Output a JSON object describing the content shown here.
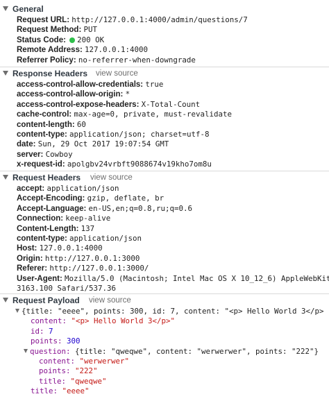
{
  "general": {
    "title": "General",
    "rows": [
      {
        "key": "Request URL:",
        "value": "http://127.0.0.1:4000/admin/questions/7"
      },
      {
        "key": "Request Method:",
        "value": "PUT"
      },
      {
        "key": "Status Code:",
        "value": "200 OK"
      },
      {
        "key": "Remote Address:",
        "value": "127.0.0.1:4000"
      },
      {
        "key": "Referrer Policy:",
        "value": "no-referrer-when-downgrade"
      }
    ]
  },
  "response_headers": {
    "title": "Response Headers",
    "view_source": "view source",
    "rows": [
      {
        "key": "access-control-allow-credentials:",
        "value": "true"
      },
      {
        "key": "access-control-allow-origin:",
        "value": "*"
      },
      {
        "key": "access-control-expose-headers:",
        "value": "X-Total-Count"
      },
      {
        "key": "cache-control:",
        "value": "max-age=0, private, must-revalidate"
      },
      {
        "key": "content-length:",
        "value": "60"
      },
      {
        "key": "content-type:",
        "value": "application/json; charset=utf-8"
      },
      {
        "key": "date:",
        "value": "Sun, 29 Oct 2017 19:07:54 GMT"
      },
      {
        "key": "server:",
        "value": "Cowboy"
      },
      {
        "key": "x-request-id:",
        "value": "apolgbv24vrbft9088674v19kho7om8u"
      }
    ]
  },
  "request_headers": {
    "title": "Request Headers",
    "view_source": "view source",
    "rows": [
      {
        "key": "accept:",
        "value": "application/json"
      },
      {
        "key": "Accept-Encoding:",
        "value": "gzip, deflate, br"
      },
      {
        "key": "Accept-Language:",
        "value": "en-US,en;q=0.8,ru;q=0.6"
      },
      {
        "key": "Connection:",
        "value": "keep-alive"
      },
      {
        "key": "Content-Length:",
        "value": "137"
      },
      {
        "key": "content-type:",
        "value": "application/json"
      },
      {
        "key": "Host:",
        "value": "127.0.0.1:4000"
      },
      {
        "key": "Origin:",
        "value": "http://127.0.0.1:3000"
      },
      {
        "key": "Referer:",
        "value": "http://127.0.0.1:3000/"
      },
      {
        "key": "User-Agent:",
        "value": "Mozilla/5.0 (Macintosh; Intel Mac OS X 10_12_6) AppleWebKit/537.36"
      }
    ],
    "user_agent_wrap": "3163.100 Safari/537.36"
  },
  "request_payload": {
    "title": "Request Payload",
    "view_source": "view source",
    "summary": "{title: \"eeee\", points: 300, id: 7, content: \"<p> Hello World 3</p>\",…}",
    "content_key": "content:",
    "content_value": "\"<p> Hello World 3</p>\"",
    "id_key": "id:",
    "id_value": "7",
    "points_key": "points:",
    "points_value": "300",
    "question_key": "question:",
    "question_summary": "{title: \"qweqwe\", content: \"werwerwer\", points: \"222\"}",
    "q_content_key": "content:",
    "q_content_value": "\"werwerwer\"",
    "q_points_key": "points:",
    "q_points_value": "\"222\"",
    "q_title_key": "title:",
    "q_title_value": "\"qweqwe\"",
    "title_key": "title:",
    "title_value": "\"eeee\""
  },
  "colors": {
    "status_dot": "#2fbf4b",
    "key_purple": "#881391",
    "string_red": "#c41a16",
    "number_blue": "#1c00cf"
  }
}
